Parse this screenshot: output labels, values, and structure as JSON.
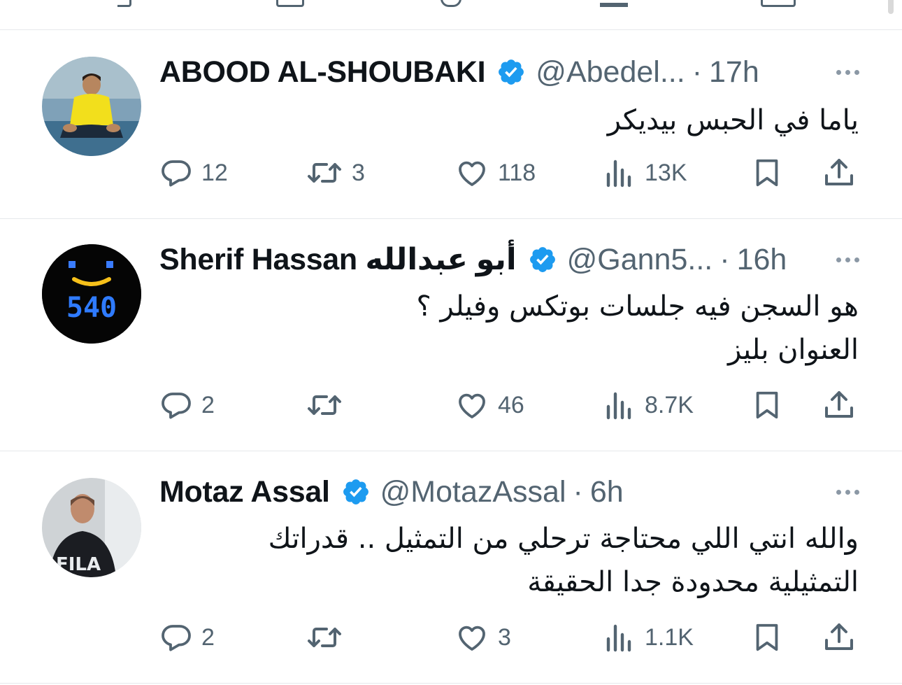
{
  "colors": {
    "text": "#0f1419",
    "secondary": "#536471",
    "verified": "#1d9bf0",
    "divider": "#e6e8eb"
  },
  "icons": [
    "reply-icon",
    "retweet-icon",
    "like-icon",
    "views-icon",
    "bookmark-icon",
    "share-icon",
    "verified-badge-icon",
    "more-icon"
  ],
  "tweets": [
    {
      "name": "ABOOD AL-SHOUBAKI",
      "handle": "@Abedel...",
      "separator": "·",
      "time": "17h",
      "lines": [
        "ياما في الحبس بيديكر"
      ],
      "replies": "12",
      "retweets": "3",
      "likes": "118",
      "views": "13K"
    },
    {
      "name": "Sherif Hassan أبو عبدالله",
      "handle": "@Gann5...",
      "separator": "·",
      "time": "16h",
      "lines": [
        "هو السجن فيه جلسات بوتكس وفيلر ؟",
        "العنوان بليز"
      ],
      "replies": "2",
      "retweets": "",
      "likes": "46",
      "views": "8.7K",
      "avatar_text": "540"
    },
    {
      "name": "Motaz Assal",
      "handle": "@MotazAssal",
      "separator": "·",
      "time": "6h",
      "lines": [
        "والله انتي اللي محتاجة ترحلي من التمثيل .. قدراتك",
        "التمثيلية محدودة جدا الحقيقة"
      ],
      "replies": "2",
      "retweets": "",
      "likes": "3",
      "views": "1.1K",
      "avatar_text": "FILA"
    }
  ]
}
